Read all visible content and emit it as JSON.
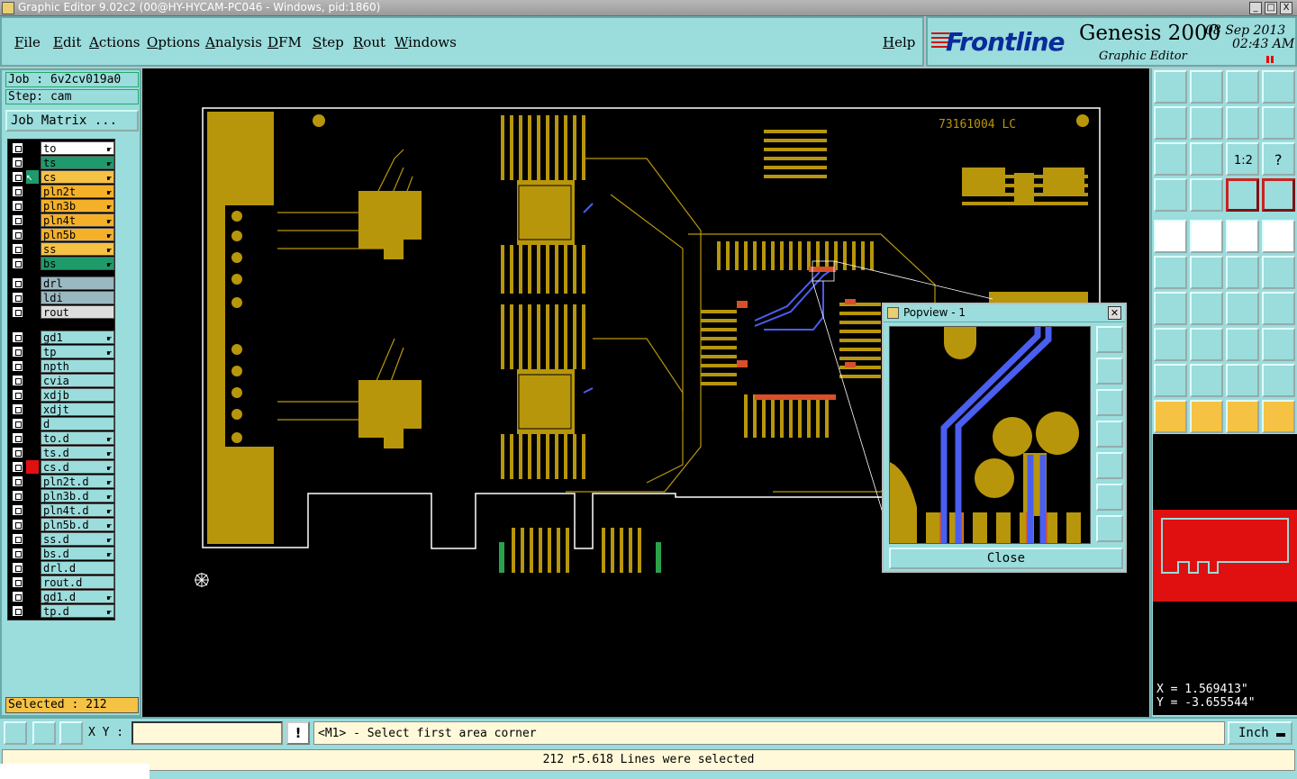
{
  "window": {
    "title": "Graphic Editor 9.02c2 (00@HY-HYCAM-PC046 - Windows, pid:1860)",
    "minimize": "_",
    "maximize": "□",
    "close": "X"
  },
  "menu": [
    "File",
    "Edit",
    "Actions",
    "Options",
    "Analysis",
    "DFM",
    "Step",
    "Rout",
    "Windows"
  ],
  "help_label": "Help",
  "brand": {
    "logo": "Frontline",
    "product": "Genesis 2000",
    "subtitle": "Graphic Editor",
    "date": "08 Sep 2013",
    "time": "02:43 AM"
  },
  "job": {
    "job_label": "Job : 6v2cv019a0",
    "step_label": "Step: cam",
    "job_matrix_button": "Job Matrix ..."
  },
  "layers": [
    {
      "name": "to",
      "color": "#ffffff",
      "hand": true
    },
    {
      "name": "ts",
      "color": "#1f9a6a",
      "hand": true
    },
    {
      "name": "cs",
      "color": "#f5c244",
      "hand": true,
      "active": true
    },
    {
      "name": "pln2t",
      "color": "#f5b02a",
      "hand": true
    },
    {
      "name": "pln3b",
      "color": "#f5b02a",
      "hand": true
    },
    {
      "name": "pln4t",
      "color": "#f5b02a",
      "hand": true
    },
    {
      "name": "pln5b",
      "color": "#f5b02a",
      "hand": true
    },
    {
      "name": "ss",
      "color": "#f5c244",
      "hand": true
    },
    {
      "name": "bs",
      "color": "#1f9a6a",
      "hand": true
    },
    {
      "name": "drl",
      "color": "#9ab8c0",
      "hand": false
    },
    {
      "name": "ldi",
      "color": "#9ab8c0",
      "hand": false
    },
    {
      "name": "rout",
      "color": "#dddddd",
      "hand": false
    },
    {
      "name": "gd1",
      "color": "#9bdcdc",
      "hand": true
    },
    {
      "name": "tp",
      "color": "#9bdcdc",
      "hand": true
    },
    {
      "name": "npth",
      "color": "#9bdcdc",
      "hand": false
    },
    {
      "name": "cvia",
      "color": "#9bdcdc",
      "hand": false
    },
    {
      "name": "xdjb",
      "color": "#9bdcdc",
      "hand": false
    },
    {
      "name": "xdjt",
      "color": "#9bdcdc",
      "hand": false
    },
    {
      "name": "d",
      "color": "#9bdcdc",
      "hand": false
    },
    {
      "name": "to.d",
      "color": "#9bdcdc",
      "hand": true
    },
    {
      "name": "ts.d",
      "color": "#9bdcdc",
      "hand": true
    },
    {
      "name": "cs.d",
      "color": "#9bdcdc",
      "hand": true,
      "red_mark": true
    },
    {
      "name": "pln2t.d",
      "color": "#9bdcdc",
      "hand": true
    },
    {
      "name": "pln3b.d",
      "color": "#9bdcdc",
      "hand": true
    },
    {
      "name": "pln4t.d",
      "color": "#9bdcdc",
      "hand": true
    },
    {
      "name": "pln5b.d",
      "color": "#9bdcdc",
      "hand": true
    },
    {
      "name": "ss.d",
      "color": "#9bdcdc",
      "hand": true
    },
    {
      "name": "bs.d",
      "color": "#9bdcdc",
      "hand": true
    },
    {
      "name": "drl.d",
      "color": "#9bdcdc",
      "hand": false
    },
    {
      "name": "rout.d",
      "color": "#9bdcdc",
      "hand": false
    },
    {
      "name": "gd1.d",
      "color": "#9bdcdc",
      "hand": true
    },
    {
      "name": "tp.d",
      "color": "#9bdcdc",
      "hand": true
    }
  ],
  "selected_label": "Selected : 212",
  "board": {
    "part_number": "73161004 LC",
    "copper_color": "#b8960c",
    "trace_color": "#4a5ef0",
    "highlight_color": "#d8502a"
  },
  "popview": {
    "title": "Popview - 1",
    "close_label": "Close"
  },
  "coords": {
    "x": "X = 1.569413\"",
    "y": "Y = -3.655544\""
  },
  "bottom": {
    "xy_label": "X Y :",
    "xy_value": "",
    "prompt": "<M1> - Select first area corner",
    "unit": "Inch",
    "status": "212 r5.618 Lines were selected"
  },
  "colors": {
    "panel": "#9bdcdc",
    "selected": "#f5c244",
    "overview": "#e01010"
  }
}
